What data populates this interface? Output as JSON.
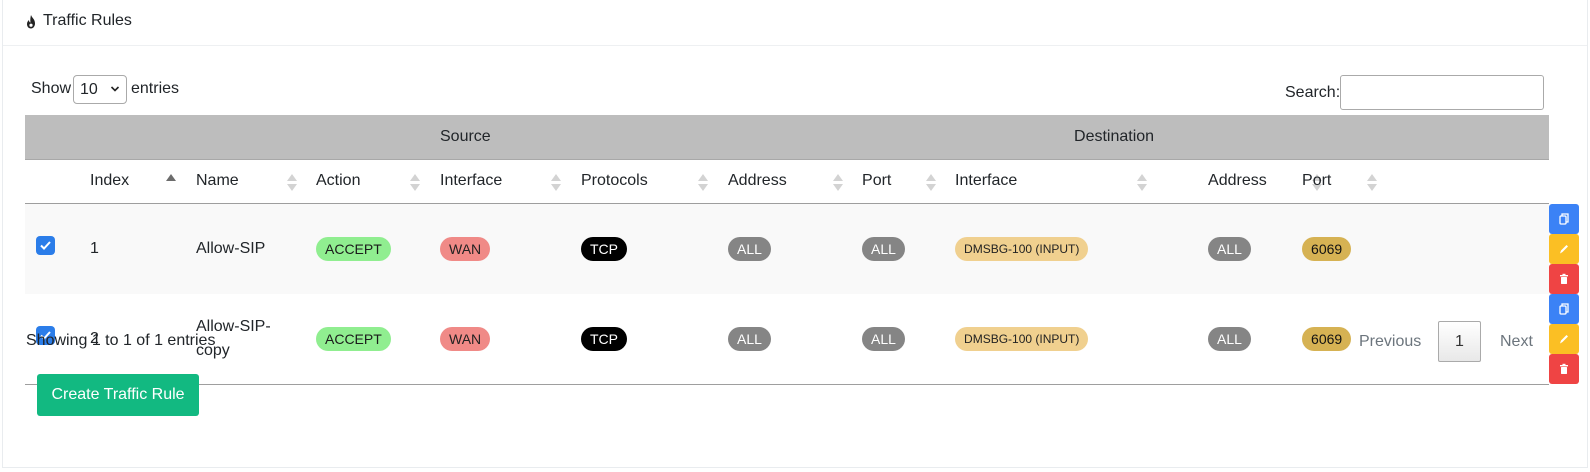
{
  "header": {
    "title": "Traffic Rules",
    "icon": "fire-icon"
  },
  "length_menu": {
    "show_label": "Show",
    "selected": "10",
    "entries_label": "entries"
  },
  "search": {
    "label": "Search:",
    "value": ""
  },
  "table": {
    "group_headers": {
      "source": "Source",
      "destination": "Destination"
    },
    "columns": [
      "Index",
      "Name",
      "Action",
      "Interface",
      "Protocols",
      "Address",
      "Port",
      "Interface",
      "Address",
      "Port"
    ],
    "rows": [
      {
        "checked": true,
        "index": "1",
        "name": "Allow-SIP",
        "action": "ACCEPT",
        "src_interface": "WAN",
        "protocols": "TCP",
        "src_address": "ALL",
        "src_port": "ALL",
        "dst_interface": "DMSBG-100 (INPUT)",
        "dst_address": "ALL",
        "dst_port": "6069"
      },
      {
        "checked": true,
        "index": "2",
        "name": "Allow-SIP-copy",
        "action": "ACCEPT",
        "src_interface": "WAN",
        "protocols": "TCP",
        "src_address": "ALL",
        "src_port": "ALL",
        "dst_interface": "DMSBG-100 (INPUT)",
        "dst_address": "ALL",
        "dst_port": "6069"
      }
    ]
  },
  "info": "Showing 1 to 1 of 1 entries",
  "pagination": {
    "previous": "Previous",
    "current": "1",
    "next": "Next"
  },
  "create_button": "Create Traffic Rule",
  "colors": {
    "accept": "#90ee90",
    "wan": "#f08a87",
    "tcp": "#000000",
    "all": "#858585",
    "dst_interface": "#f0d08f",
    "port": "#d6b253",
    "copy": "#3b82f6",
    "edit": "#fbbf24",
    "delete": "#ef4444",
    "create": "#12b981"
  }
}
